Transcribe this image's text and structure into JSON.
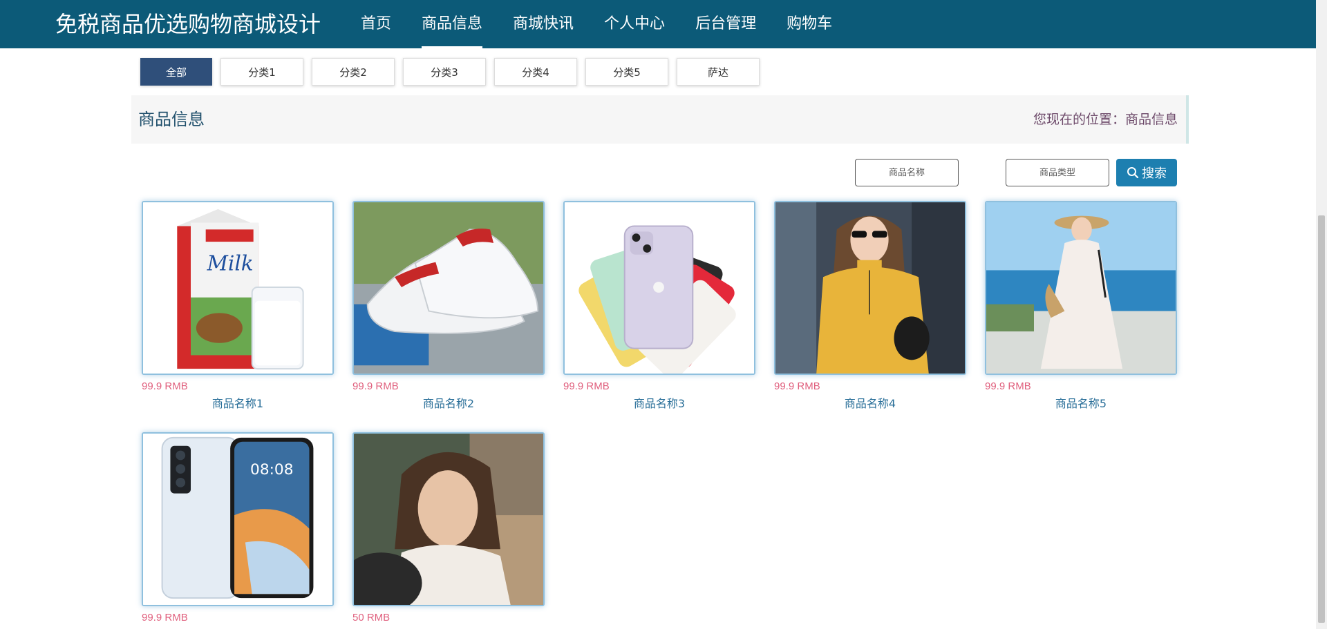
{
  "header": {
    "site_title": "免税商品优选购物商城设计",
    "nav": [
      "首页",
      "商品信息",
      "商城快讯",
      "个人中心",
      "后台管理",
      "购物车"
    ],
    "active_nav": "商品信息",
    "bg_color": "#0c5a78"
  },
  "categories": {
    "items": [
      "全部",
      "分类1",
      "分类2",
      "分类3",
      "分类4",
      "分类5",
      "萨达"
    ],
    "active": "全部"
  },
  "section": {
    "title": "商品信息",
    "breadcrumb": "您现在的位置：商品信息"
  },
  "search": {
    "name_placeholder": "商品名称",
    "type_placeholder": "商品类型",
    "button_label": "搜索"
  },
  "products": [
    {
      "price": "99.9 RMB",
      "name": "商品名称1",
      "image": "milk-carton-and-glass"
    },
    {
      "price": "99.9 RMB",
      "name": "商品名称2",
      "image": "white-sneakers"
    },
    {
      "price": "99.9 RMB",
      "name": "商品名称3",
      "image": "iphone-11-colors"
    },
    {
      "price": "99.9 RMB",
      "name": "商品名称4",
      "image": "woman-yellow-sweater"
    },
    {
      "price": "99.9 RMB",
      "name": "商品名称5",
      "image": "woman-white-dress-beach"
    },
    {
      "price": "99.9 RMB",
      "name": "",
      "image": "huawei-phone"
    },
    {
      "price": "50 RMB",
      "name": "",
      "image": "woman-portrait"
    }
  ],
  "colors": {
    "price": "#e0607e",
    "product_name": "#2a6f99",
    "search_button": "#1d7fb0",
    "active_category": "#2f4f7a"
  }
}
